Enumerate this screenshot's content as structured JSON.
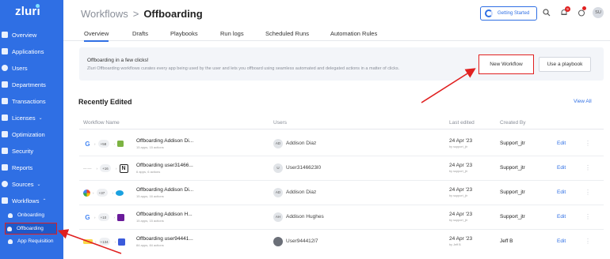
{
  "sidebar": {
    "logo": "zluri",
    "items": [
      {
        "label": "Overview",
        "icon": "grid-icon"
      },
      {
        "label": "Applications",
        "icon": "apps-icon"
      },
      {
        "label": "Users",
        "icon": "users-icon"
      },
      {
        "label": "Departments",
        "icon": "departments-icon"
      },
      {
        "label": "Transactions",
        "icon": "transactions-icon"
      },
      {
        "label": "Licenses",
        "icon": "licenses-icon"
      },
      {
        "label": "Optimization",
        "icon": "optimization-icon"
      },
      {
        "label": "Security",
        "icon": "shield-icon"
      },
      {
        "label": "Reports",
        "icon": "reports-icon"
      },
      {
        "label": "Sources",
        "icon": "sources-icon"
      },
      {
        "label": "Workflows",
        "icon": "workflows-icon"
      }
    ],
    "sub_items": [
      {
        "label": "Onboarding"
      },
      {
        "label": "Offboarding"
      },
      {
        "label": "App Requisition"
      }
    ]
  },
  "header": {
    "breadcrumb_parent": "Workflows",
    "breadcrumb_sep": ">",
    "breadcrumb_current": "Offboarding",
    "getting_started": "Getting Started",
    "notif_count": "9",
    "avatar_initials": "SU"
  },
  "tabs": [
    "Overview",
    "Drafts",
    "Playbooks",
    "Run logs",
    "Scheduled Runs",
    "Automation Rules"
  ],
  "banner": {
    "title": "Offboarding in a few clicks!",
    "description": "Zluri Offboarding workflows curates every app being used by the user and lets you offboard using seamless automated and delegated actions in a matter of clicks.",
    "new_workflow": "New Workflow",
    "use_playbook": "Use a playbook"
  },
  "recent": {
    "title": "Recently Edited",
    "view_all": "View All",
    "columns": {
      "workflow": "Workflow Name",
      "users": "Users",
      "last_edited": "Last edited",
      "created_by": "Created By"
    },
    "rows": [
      {
        "count": "+58",
        "name": "Offboarding Addison Di...",
        "sub": "15 apps, 15 actions",
        "user_initials": "AD",
        "user": "Addison Diaz",
        "date": "24 Apr '23",
        "date_sub": "by support_jtr",
        "creator": "Support_jtr",
        "edit": "Edit"
      },
      {
        "count": "+16",
        "name": "Offboarding user31466...",
        "sub": "6 apps, 6 actions",
        "user_initials": "U",
        "user": "User3146623l0",
        "date": "24 Apr '23",
        "date_sub": "by support_jtr",
        "creator": "Support_jtr",
        "edit": "Edit"
      },
      {
        "count": "+37",
        "name": "Offboarding Addison Di...",
        "sub": "15 apps, 16 actions",
        "user_initials": "AD",
        "user": "Addison Diaz",
        "date": "24 Apr '23",
        "date_sub": "by support_jtr",
        "creator": "Support_jtr",
        "edit": "Edit"
      },
      {
        "count": "+10",
        "name": "Offboarding Addison H...",
        "sub": "15 apps, 15 actions",
        "user_initials": "AH",
        "user": "Addison Hughes",
        "date": "24 Apr '23",
        "date_sub": "by support_jtr",
        "creator": "Support_jtr",
        "edit": "Edit"
      },
      {
        "count": "+134",
        "name": "Offboarding user94441...",
        "sub": "84 apps, 84 actions",
        "user_initials": "",
        "user": "User944412l7",
        "date": "24 Apr '23",
        "date_sub": "by Jeff B",
        "creator": "Jeff B",
        "edit": "Edit"
      }
    ]
  },
  "colors": {
    "brand": "#2f6fe4",
    "annotation": "#e02020"
  }
}
